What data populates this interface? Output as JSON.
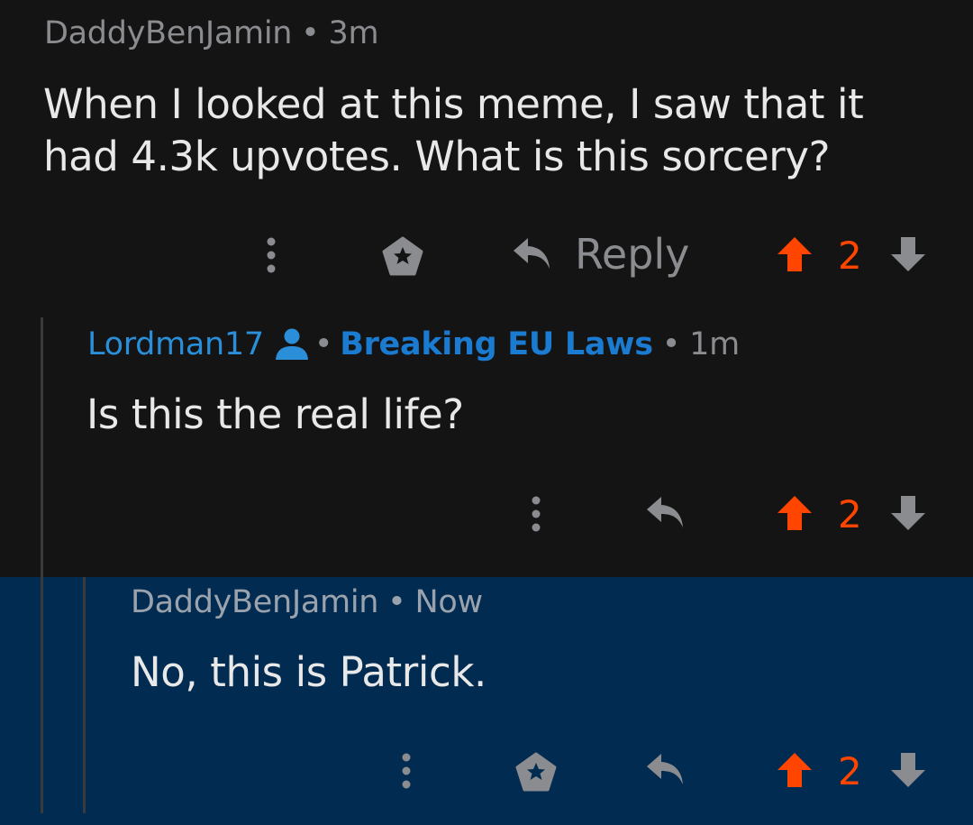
{
  "comments": [
    {
      "author": "DaddyBenJamin",
      "time": "3m",
      "body_line1": "When I looked at this meme, I saw that it",
      "body_line2": "had 4.3k upvotes. What is this sorcery?",
      "reply_label": "Reply",
      "votes": "2"
    },
    {
      "author": "Lordman17",
      "flair": "Breaking EU Laws",
      "time": "1m",
      "body": "Is this the real life?",
      "votes": "2"
    },
    {
      "author": "DaddyBenJamin",
      "time": "Now",
      "body": "No, this is Patrick.",
      "votes": "2"
    }
  ],
  "separator": "•",
  "colors": {
    "background": "#141414",
    "highlight": "#012b50",
    "upvote": "#ff4500",
    "muted": "#8a8c8f",
    "username_blue": "#2a8fd8",
    "flair_blue": "#1a7bd1"
  },
  "icons": [
    "more-vertical-icon",
    "award-icon",
    "reply-arrow-icon",
    "upvote-arrow-icon",
    "downvote-arrow-icon",
    "user-icon"
  ]
}
